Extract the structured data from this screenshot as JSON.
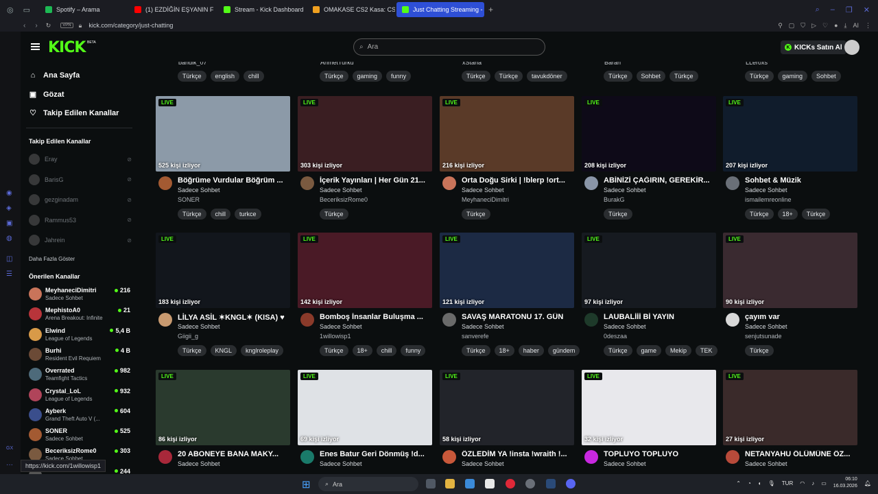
{
  "browser": {
    "tabs": [
      {
        "label": "Spotify – Arama",
        "color": "#1db954",
        "active": false
      },
      {
        "label": "(1) EZDİĞİN EŞYANIN F",
        "color": "#ff0000",
        "active": false
      },
      {
        "label": "Stream - Kick Dashboard",
        "color": "#53fc18",
        "active": false
      },
      {
        "label": "OMAKASE CS2 Kasa: CS2",
        "color": "#f0a020",
        "active": false
      },
      {
        "label": "Just Chatting Streaming -",
        "color": "#53fc18",
        "active": true
      }
    ],
    "url": "kick.com/category/just-chatting",
    "vpn_label": "VPN",
    "ai_label": "AI",
    "status_url": "https://kick.com/1willowisp1"
  },
  "header": {
    "logo": "KICK",
    "beta": "BETA",
    "search_placeholder": "Ara",
    "kicks_button": "KICKs Satın Al"
  },
  "sidebar": {
    "nav": [
      {
        "label": "Ana Sayfa",
        "icon": "home-icon"
      },
      {
        "label": "Gözat",
        "icon": "browse-icon"
      },
      {
        "label": "Takip Edilen Kanallar",
        "icon": "heart-icon"
      }
    ],
    "followed_title": "Takip Edilen Kanallar",
    "followed": [
      "Eray",
      "BarisG",
      "gezginadam",
      "Rammus53",
      "Jahrein"
    ],
    "show_more": "Daha Fazla Göster",
    "recommended_title": "Önerilen Kanallar",
    "recommended": [
      {
        "name": "MeyhaneciDimitri",
        "category": "Sadece Sohbet",
        "viewers": "216",
        "color": "#c9745a"
      },
      {
        "name": "MephistoA0",
        "category": "Arena Breakout: Infinite",
        "viewers": "21",
        "color": "#b8343a"
      },
      {
        "name": "Elwind",
        "category": "League of Legends",
        "viewers": "5,4 B",
        "color": "#d89a48"
      },
      {
        "name": "Burhi",
        "category": "Resident Evil Requiem",
        "viewers": "4 B",
        "color": "#6b4a36"
      },
      {
        "name": "Overrated",
        "category": "Teamfight Tactics",
        "viewers": "982",
        "color": "#4d6a7a"
      },
      {
        "name": "Crystal_LoL",
        "category": "League of Legends",
        "viewers": "932",
        "color": "#b0445a"
      },
      {
        "name": "Ayberk",
        "category": "Grand Theft Auto V (...",
        "viewers": "604",
        "color": "#3a4e8c"
      },
      {
        "name": "SONER",
        "category": "Sadece Sohbet",
        "viewers": "525",
        "color": "#a35a32"
      },
      {
        "name": "BeceriksizRome0",
        "category": "Sadece Sohbet",
        "viewers": "303",
        "color": "#7a5a40"
      },
      {
        "name": "",
        "category": "",
        "viewers": "244",
        "color": "#555555"
      }
    ]
  },
  "top_row": [
    {
      "name": "bandik_07",
      "tags": [
        "Türkçe",
        "english",
        "chill"
      ]
    },
    {
      "name": "AhmetTurku",
      "tags": [
        "Türkçe",
        "gaming",
        "funny"
      ]
    },
    {
      "name": "xStana",
      "tags": [
        "Türkçe",
        "Türkçe",
        "tavukdöner"
      ]
    },
    {
      "name": "Baran",
      "tags": [
        "Türkçe",
        "Sohbet",
        "Türkçe"
      ]
    },
    {
      "name": "LLeroxs",
      "tags": [
        "Türkçe",
        "gaming",
        "Sohbet"
      ]
    }
  ],
  "cards": [
    {
      "live": "LIVE",
      "viewers": "525 kişi izliyor",
      "title": "Böğrüme Vurdular Böğrüm ...",
      "category": "Sadece Sohbet",
      "channel": "SONER",
      "tags": [
        "Türkçe",
        "chill",
        "turkce"
      ],
      "bg": "#8c9aa8",
      "av": "#a35a32"
    },
    {
      "live": "LIVE",
      "viewers": "303 kişi izliyor",
      "title": "İçerik Yayınları | Her Gün 21...",
      "category": "Sadece Sohbet",
      "channel": "BeceriksizRome0",
      "tags": [
        "Türkçe"
      ],
      "bg": "#3a1e22",
      "av": "#7a5a40"
    },
    {
      "live": "LIVE",
      "viewers": "216 kişi izliyor",
      "title": "Orta Doğu Sirki | !blerp !ort...",
      "category": "Sadece Sohbet",
      "channel": "MeyhaneciDimitri",
      "tags": [
        "Türkçe"
      ],
      "bg": "#5a3a28",
      "av": "#c9745a"
    },
    {
      "live": "LIVE",
      "viewers": "208 kişi izliyor",
      "title": "ABİNİZİ ÇAĞIRIN, GEREKİR...",
      "category": "Sadece Sohbet",
      "channel": "BurakG",
      "tags": [
        "Türkçe"
      ],
      "bg": "#0e0a18",
      "av": "#8a96a8"
    },
    {
      "live": "LIVE",
      "viewers": "207 kişi izliyor",
      "title": "Sohbet & Müzik",
      "category": "Sadece Sohbet",
      "channel": "ismailemreonline",
      "tags": [
        "Türkçe",
        "18+",
        "Türkçe"
      ],
      "bg": "#101c2c",
      "av": "#6a7078"
    },
    {
      "live": "LIVE",
      "viewers": "183 kişi izliyor",
      "title": "LİLYA ASİL ✶KNGL✶ (KISA) ♥",
      "category": "Sadece Sohbet",
      "channel": "Giigii_g",
      "tags": [
        "Türkçe",
        "KNGL",
        "knglroleplay"
      ],
      "bg": "#12161c",
      "av": "#c89a70"
    },
    {
      "live": "LIVE",
      "viewers": "142 kişi izliyor",
      "title": "Bomboş İnsanlar Buluşma ...",
      "category": "Sadece Sohbet",
      "channel": "1willowisp1",
      "tags": [
        "Türkçe",
        "18+",
        "chill",
        "funny"
      ],
      "bg": "#4a1a26",
      "av": "#8a3a2a"
    },
    {
      "live": "LIVE",
      "viewers": "121 kişi izliyor",
      "title": "SAVAŞ MARATONU 17. GÜN",
      "category": "Sadece Sohbet",
      "channel": "sanverefe",
      "tags": [
        "Türkçe",
        "18+",
        "haber",
        "gündem"
      ],
      "bg": "#1c2a44",
      "av": "#6a6a6a"
    },
    {
      "live": "LIVE",
      "viewers": "97 kişi izliyor",
      "title": "LAUBALİİİ Bİ YAYIN",
      "category": "Sadece Sohbet",
      "channel": "0deszaa",
      "tags": [
        "Türkçe",
        "game",
        "Mekip",
        "TEK"
      ],
      "bg": "#161a20",
      "av": "#1e3a2a"
    },
    {
      "live": "LIVE",
      "viewers": "90 kişi izliyor",
      "title": "çayım var",
      "category": "Sadece Sohbet",
      "channel": "senjutsunade",
      "tags": [
        "Türkçe"
      ],
      "bg": "#3a2a30",
      "av": "#d8d8d8"
    },
    {
      "live": "LIVE",
      "viewers": "86 kişi izliyor",
      "title": "20 ABONEYE BANA MAKY...",
      "category": "Sadece Sohbet",
      "channel": "",
      "tags": [],
      "bg": "#2a3a2e",
      "av": "#a8283a"
    },
    {
      "live": "LIVE",
      "viewers": "69 kişi izliyor",
      "title": "Enes Batur Geri Dönmüş !d...",
      "category": "Sadece Sohbet",
      "channel": "",
      "tags": [],
      "bg": "#dfe2e6",
      "av": "#1a7a6a"
    },
    {
      "live": "LIVE",
      "viewers": "58 kişi izliyor",
      "title": "ÖZLEDİM YA !insta !wraith !...",
      "category": "Sadece Sohbet",
      "channel": "",
      "tags": [],
      "bg": "#22242a",
      "av": "#c8583a"
    },
    {
      "live": "LIVE",
      "viewers": "32 kişi izliyor",
      "title": "TOPLUYO TOPLUYO",
      "category": "Sadece Sohbet",
      "channel": "",
      "tags": [],
      "bg": "#e8e8ec",
      "av": "#c828e0"
    },
    {
      "live": "LIVE",
      "viewers": "27 kişi izliyor",
      "title": "NETANYAHU ÖLÜMÜNE ÖZ...",
      "category": "Sadece Sohbet",
      "channel": "",
      "tags": [],
      "bg": "#3a2a2a",
      "av": "#b84a3a"
    }
  ],
  "taskbar": {
    "search": "Ara",
    "lang": "TUR",
    "time": "06:10",
    "date": "16.03.2026"
  }
}
